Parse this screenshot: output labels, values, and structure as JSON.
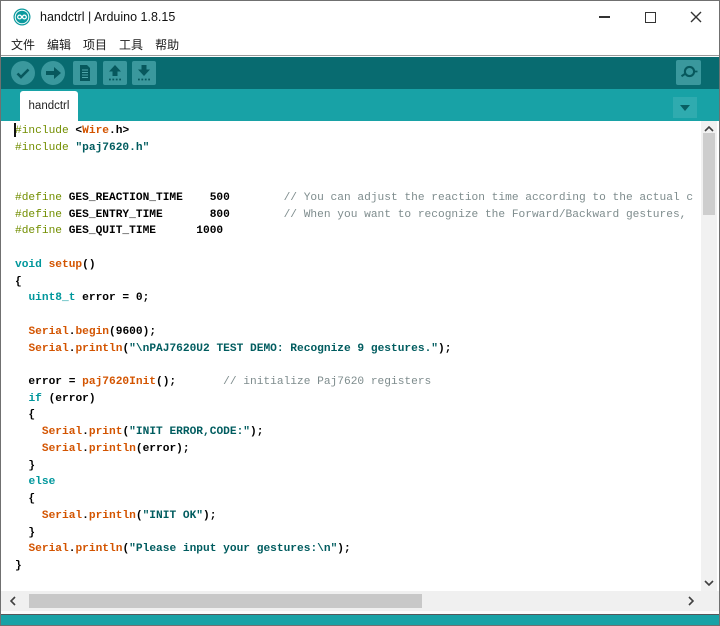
{
  "window": {
    "title": "handctrl | Arduino 1.8.15",
    "app_icon": "infinity-logo",
    "accent_color": "#00979C",
    "toolbar_color": "#086b70",
    "tabstrip_color": "#18a2a6"
  },
  "menu": {
    "items": [
      "文件",
      "编辑",
      "项目",
      "工具",
      "帮助"
    ]
  },
  "toolbar": {
    "buttons": [
      "verify",
      "upload",
      "new",
      "open",
      "save",
      "serial-monitor"
    ]
  },
  "tabs": {
    "active": "handctrl"
  },
  "editor": {
    "lines": [
      [
        [
          "p",
          "#include"
        ],
        [
          "t",
          " <"
        ],
        [
          "f",
          "Wire"
        ],
        [
          "t",
          ".h>"
        ]
      ],
      [
        [
          "p",
          "#include"
        ],
        [
          "t",
          " "
        ],
        [
          "s",
          "\"paj7620.h\""
        ]
      ],
      [],
      [],
      [
        [
          "p",
          "#define"
        ],
        [
          "t",
          " GES_REACTION_TIME    500        "
        ],
        [
          "c",
          "// You can adjust the reaction time according to the actual c"
        ]
      ],
      [
        [
          "p",
          "#define"
        ],
        [
          "t",
          " GES_ENTRY_TIME       800        "
        ],
        [
          "c",
          "// When you want to recognize the Forward/Backward gestures,"
        ]
      ],
      [
        [
          "p",
          "#define"
        ],
        [
          "t",
          " GES_QUIT_TIME      1000"
        ]
      ],
      [],
      [
        [
          "k",
          "void"
        ],
        [
          "t",
          " "
        ],
        [
          "f",
          "setup"
        ],
        [
          "t",
          "()"
        ]
      ],
      [
        [
          "t",
          "{"
        ]
      ],
      [
        [
          "t",
          "  "
        ],
        [
          "k",
          "uint8_t"
        ],
        [
          "t",
          " error = 0;"
        ]
      ],
      [],
      [
        [
          "t",
          "  "
        ],
        [
          "f",
          "Serial"
        ],
        [
          "t",
          "."
        ],
        [
          "f",
          "begin"
        ],
        [
          "t",
          "(9600);"
        ]
      ],
      [
        [
          "t",
          "  "
        ],
        [
          "f",
          "Serial"
        ],
        [
          "t",
          "."
        ],
        [
          "f",
          "println"
        ],
        [
          "t",
          "("
        ],
        [
          "s",
          "\"\\nPAJ7620U2 TEST DEMO: Recognize 9 gestures.\""
        ],
        [
          "t",
          ");"
        ]
      ],
      [],
      [
        [
          "t",
          "  error = "
        ],
        [
          "f",
          "paj7620Init"
        ],
        [
          "t",
          "();       "
        ],
        [
          "c",
          "// initialize Paj7620 registers"
        ]
      ],
      [
        [
          "t",
          "  "
        ],
        [
          "k",
          "if"
        ],
        [
          "t",
          " (error)"
        ]
      ],
      [
        [
          "t",
          "  {"
        ]
      ],
      [
        [
          "t",
          "    "
        ],
        [
          "f",
          "Serial"
        ],
        [
          "t",
          "."
        ],
        [
          "f",
          "print"
        ],
        [
          "t",
          "("
        ],
        [
          "s",
          "\"INIT ERROR,CODE:\""
        ],
        [
          "t",
          ");"
        ]
      ],
      [
        [
          "t",
          "    "
        ],
        [
          "f",
          "Serial"
        ],
        [
          "t",
          "."
        ],
        [
          "f",
          "println"
        ],
        [
          "t",
          "(error);"
        ]
      ],
      [
        [
          "t",
          "  }"
        ]
      ],
      [
        [
          "t",
          "  "
        ],
        [
          "k",
          "else"
        ]
      ],
      [
        [
          "t",
          "  {"
        ]
      ],
      [
        [
          "t",
          "    "
        ],
        [
          "f",
          "Serial"
        ],
        [
          "t",
          "."
        ],
        [
          "f",
          "println"
        ],
        [
          "t",
          "("
        ],
        [
          "s",
          "\"INIT OK\""
        ],
        [
          "t",
          ");"
        ]
      ],
      [
        [
          "t",
          "  }"
        ]
      ],
      [
        [
          "t",
          "  "
        ],
        [
          "f",
          "Serial"
        ],
        [
          "t",
          "."
        ],
        [
          "f",
          "println"
        ],
        [
          "t",
          "("
        ],
        [
          "s",
          "\"Please input your gestures:\\n\""
        ],
        [
          "t",
          ");"
        ]
      ],
      [
        [
          "t",
          "}"
        ]
      ]
    ]
  }
}
